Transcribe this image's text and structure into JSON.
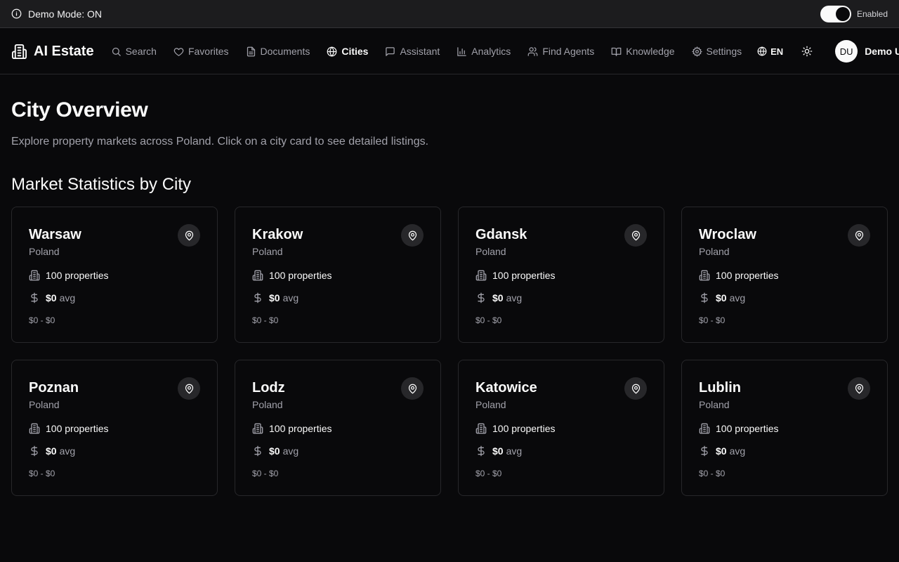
{
  "demo_bar": {
    "label": "Demo Mode: ON",
    "toggle_label": "Enabled"
  },
  "header": {
    "brand": "AI Estate",
    "nav": [
      {
        "label": "Search",
        "icon": "search-icon"
      },
      {
        "label": "Favorites",
        "icon": "heart-icon"
      },
      {
        "label": "Documents",
        "icon": "document-icon"
      },
      {
        "label": "Cities",
        "icon": "globe-icon",
        "active": true
      },
      {
        "label": "Assistant",
        "icon": "chat-icon"
      },
      {
        "label": "Analytics",
        "icon": "bar-chart-icon"
      },
      {
        "label": "Find Agents",
        "icon": "users-icon"
      },
      {
        "label": "Knowledge",
        "icon": "book-icon"
      },
      {
        "label": "Settings",
        "icon": "gear-icon"
      }
    ],
    "language": "EN",
    "user": {
      "initials": "DU",
      "name": "Demo U"
    }
  },
  "page": {
    "title": "City Overview",
    "description": "Explore property markets across Poland. Click on a city card to see detailed listings.",
    "section_title": "Market Statistics by City"
  },
  "cities": [
    {
      "name": "Warsaw",
      "country": "Poland",
      "properties": "100 properties",
      "avg_value": "$0",
      "avg_suffix": "avg",
      "range": "$0 - $0"
    },
    {
      "name": "Krakow",
      "country": "Poland",
      "properties": "100 properties",
      "avg_value": "$0",
      "avg_suffix": "avg",
      "range": "$0 - $0"
    },
    {
      "name": "Gdansk",
      "country": "Poland",
      "properties": "100 properties",
      "avg_value": "$0",
      "avg_suffix": "avg",
      "range": "$0 - $0"
    },
    {
      "name": "Wroclaw",
      "country": "Poland",
      "properties": "100 properties",
      "avg_value": "$0",
      "avg_suffix": "avg",
      "range": "$0 - $0"
    },
    {
      "name": "Poznan",
      "country": "Poland",
      "properties": "100 properties",
      "avg_value": "$0",
      "avg_suffix": "avg",
      "range": "$0 - $0"
    },
    {
      "name": "Lodz",
      "country": "Poland",
      "properties": "100 properties",
      "avg_value": "$0",
      "avg_suffix": "avg",
      "range": "$0 - $0"
    },
    {
      "name": "Katowice",
      "country": "Poland",
      "properties": "100 properties",
      "avg_value": "$0",
      "avg_suffix": "avg",
      "range": "$0 - $0"
    },
    {
      "name": "Lublin",
      "country": "Poland",
      "properties": "100 properties",
      "avg_value": "$0",
      "avg_suffix": "avg",
      "range": "$0 - $0"
    }
  ],
  "colors": {
    "background": "#09090b",
    "card_border": "#27272a",
    "muted_text": "#a1a1aa",
    "foreground": "#fafafa"
  }
}
